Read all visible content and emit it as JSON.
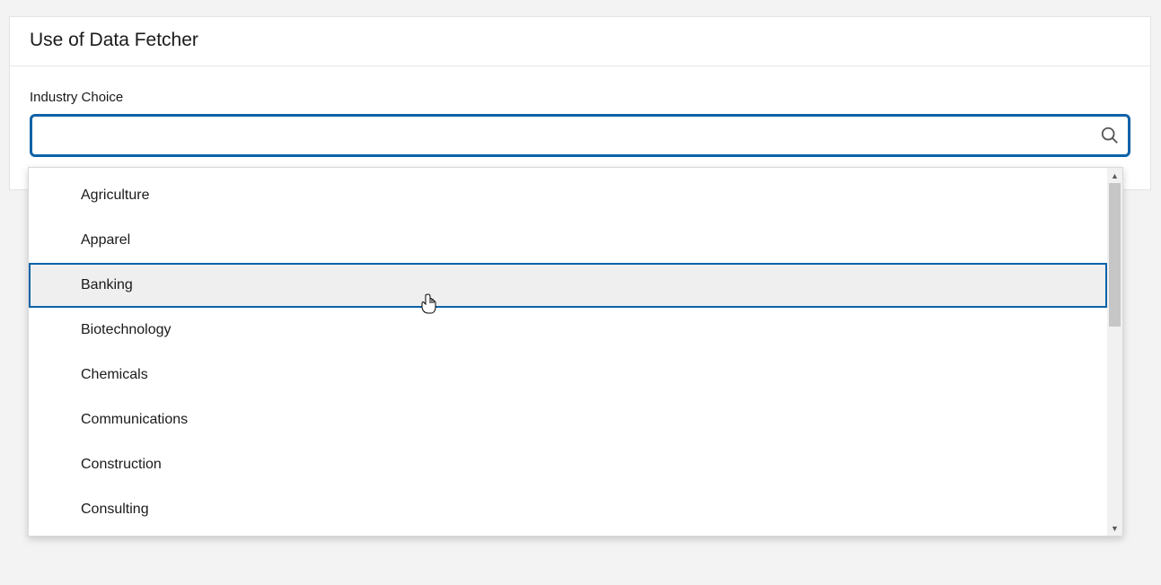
{
  "card": {
    "title": "Use of Data Fetcher"
  },
  "field": {
    "label": "Industry Choice",
    "value": "",
    "placeholder": ""
  },
  "dropdown": {
    "items": [
      {
        "label": "Agriculture",
        "highlight": false
      },
      {
        "label": "Apparel",
        "highlight": false
      },
      {
        "label": "Banking",
        "highlight": true
      },
      {
        "label": "Biotechnology",
        "highlight": false
      },
      {
        "label": "Chemicals",
        "highlight": false
      },
      {
        "label": "Communications",
        "highlight": false
      },
      {
        "label": "Construction",
        "highlight": false
      },
      {
        "label": "Consulting",
        "highlight": false
      }
    ]
  }
}
